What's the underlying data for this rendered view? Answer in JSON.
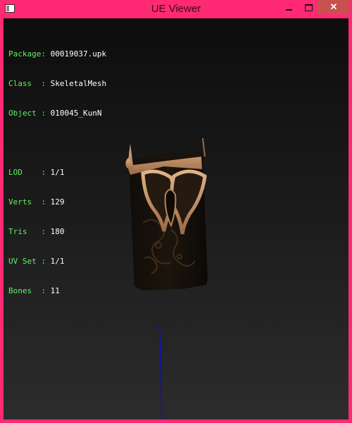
{
  "window": {
    "title": "UE Viewer"
  },
  "info": {
    "package_label": "Package:",
    "package_value": "00019037.upk",
    "class_label": "Class  :",
    "class_value": "SkeletalMesh",
    "object_label": "Object :",
    "object_value": "010045_KunN",
    "lod_label": "LOD    :",
    "lod_value": "1/1",
    "verts_label": "Verts  :",
    "verts_value": "129",
    "tris_label": "Tris   :",
    "tris_value": "180",
    "uvset_label": "UV Set :",
    "uvset_value": "1/1",
    "bones_label": "Bones  :",
    "bones_value": "11"
  },
  "colors": {
    "frame": "#ff2a73",
    "label": "#66ee66",
    "value": "#ffffff",
    "axis": "#1010c0"
  }
}
